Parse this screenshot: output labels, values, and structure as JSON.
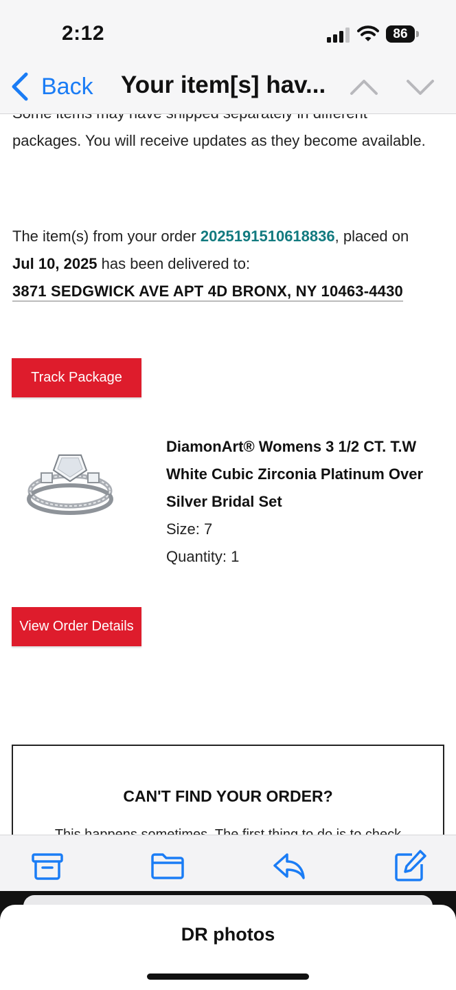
{
  "status_bar": {
    "time": "2:12",
    "battery": "86",
    "icons": [
      "cellular-signal-icon",
      "wifi-icon",
      "battery-icon"
    ]
  },
  "nav": {
    "back_label": "Back",
    "subject": "Your item[s] hav...",
    "icons": [
      "chevron-left-icon",
      "chevron-up-icon",
      "chevron-down-icon"
    ]
  },
  "email": {
    "intro_cut": "Some items may have shipped separately in different",
    "intro_rest": "packages. You will receive updates as they become available.",
    "delivery": {
      "prefix": "The item(s) from your order ",
      "order_number": "2025191510618836",
      "middle": ", placed on ",
      "date": "Jul 10, 2025",
      "suffix": " has been delivered to:",
      "address": "3871 SEDGWICK AVE APT 4D BRONX, NY 10463-4430"
    },
    "track_button": "Track Package",
    "item": {
      "title": "DiamonArt® Womens 3 1/2 CT. T.W White Cubic Zirconia Platinum Over Silver Bridal Set",
      "size": "Size: 7",
      "quantity": "Quantity: 1"
    },
    "view_order_button": "View Order Details",
    "cant_find": {
      "title": "CAN'T FIND YOUR ORDER?",
      "text": "This happens sometimes. The first thing to do is to check"
    }
  },
  "toolbar": {
    "icons": [
      "archive-icon",
      "folder-icon",
      "reply-icon",
      "compose-icon"
    ]
  },
  "draft_sheet": {
    "title": "DR photos"
  },
  "colors": {
    "accent_blue": "#1a7cf5",
    "order_link_teal": "#127a7f",
    "button_red": "#de1c2c"
  }
}
